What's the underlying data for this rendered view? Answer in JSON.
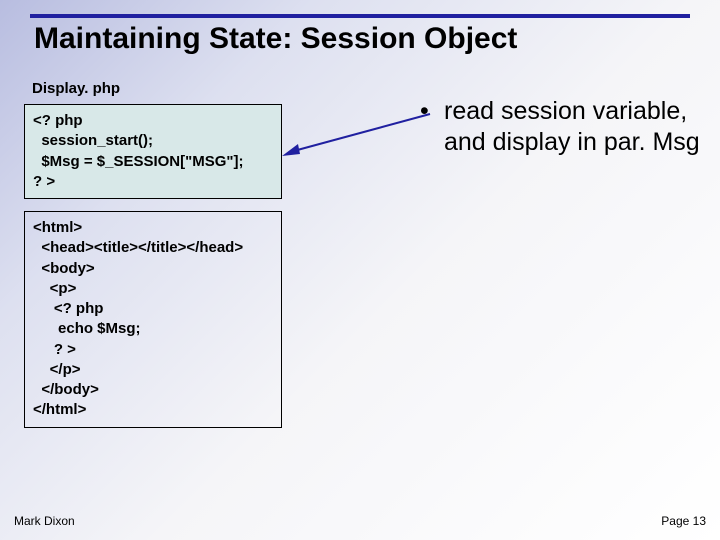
{
  "title": "Maintaining State: Session Object",
  "filename": "Display. php",
  "code_a": "<? php\n  session_start();\n  $Msg = $_SESSION[\"MSG\"];\n? >",
  "code_b": "<html>\n  <head><title></title></head>\n  <body>\n    <p>\n     <? php\n      echo $Msg;\n     ? >\n    </p>\n  </body>\n</html>",
  "bullet": "read session variable, and display in par. Msg",
  "footer_left": "Mark Dixon",
  "footer_right": "Page 13"
}
